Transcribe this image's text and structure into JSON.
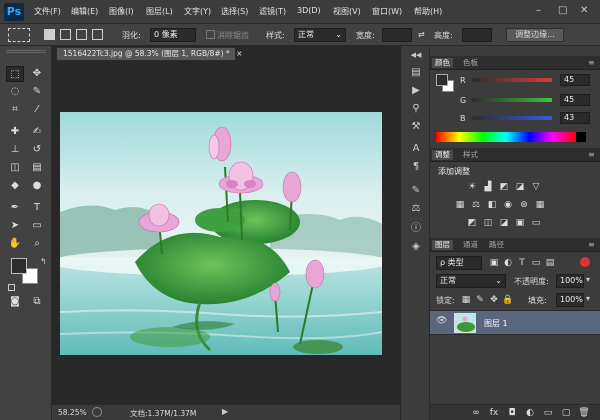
{
  "app": {
    "logo": "Ps"
  },
  "menu": [
    "文件(F)",
    "编辑(E)",
    "图像(I)",
    "图层(L)",
    "文字(Y)",
    "选择(S)",
    "滤镜(T)",
    "3D(D)",
    "视图(V)",
    "窗口(W)",
    "帮助(H)"
  ],
  "window_controls": {
    "minimize": "–",
    "restore": "□",
    "close": "✕"
  },
  "options": {
    "feather_label": "羽化:",
    "feather_value": "0 像素",
    "antialias_label": "消除锯齿",
    "style_label": "样式:",
    "style_value": "正常",
    "width_label": "宽度:",
    "height_label": "高度:",
    "refine_button": "调整边缘..."
  },
  "document": {
    "tab_title": "1516422Tc3.jpg @ 58.3% (图层 1, RGB/8#) *",
    "tab_close": "×"
  },
  "status": {
    "zoom": "58.25%",
    "doc_info": "文档:1.37M/1.37M"
  },
  "color_panel": {
    "tabs": [
      "颜色",
      "色板"
    ],
    "channels": [
      {
        "label": "R",
        "value": "45",
        "color": "#e03a3a"
      },
      {
        "label": "G",
        "value": "45",
        "color": "#3ec43e"
      },
      {
        "label": "B",
        "value": "43",
        "color": "#3a5ae0"
      }
    ]
  },
  "adjust_panel": {
    "tabs": [
      "调整",
      "样式"
    ],
    "title": "添加调整"
  },
  "layers_panel": {
    "tabs": [
      "图层",
      "通道",
      "路径"
    ],
    "filter_label": "ρ 类型",
    "blend_mode": "正常",
    "opacity_label": "不透明度:",
    "opacity_value": "100%",
    "lock_label": "锁定:",
    "fill_label": "填充:",
    "fill_value": "100%",
    "layer_name": "图层 1",
    "eye_icon_text": "👁",
    "footer_icons": [
      "∞",
      "fx",
      "◘",
      "◐",
      "▭",
      "▢",
      "🗑"
    ]
  },
  "colors": {
    "accent": "#31a8ff",
    "layer_selected": "#58667e",
    "fg": "#2d2d2b",
    "bg": "#ffffff"
  }
}
